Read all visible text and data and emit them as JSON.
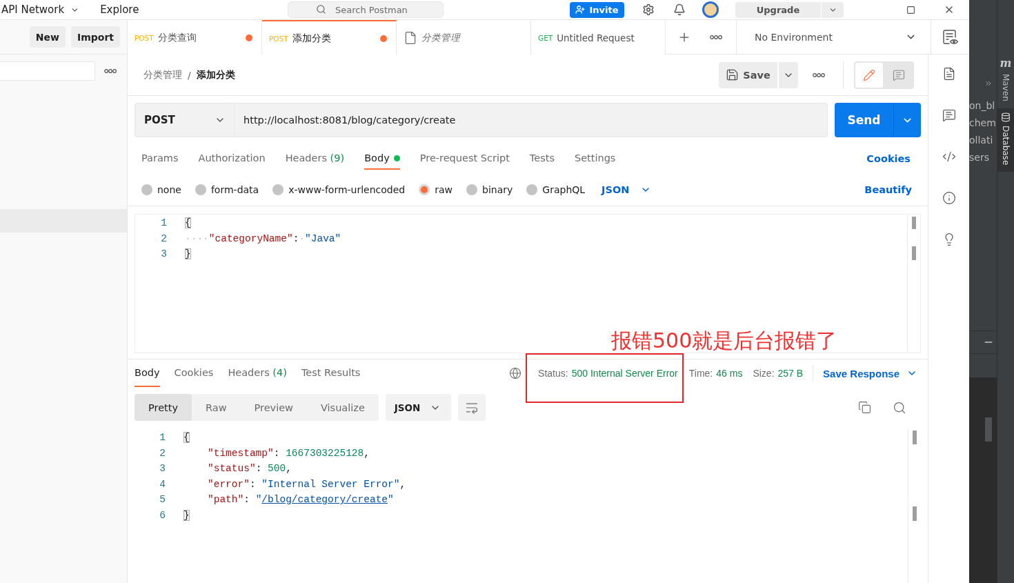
{
  "top_bar": {
    "nav": [
      {
        "label": "API Network",
        "dropdown": true
      },
      {
        "label": "Explore",
        "dropdown": false
      }
    ],
    "search": {
      "placeholder": "Search Postman"
    },
    "invite": "Invite",
    "upgrade": "Upgrade"
  },
  "sidebar": {
    "buttons": [
      "New",
      "Import"
    ]
  },
  "tabs": [
    {
      "kind": "request",
      "method": "POST",
      "color": "#ffb400",
      "title": "分类查询",
      "unsaved": true,
      "selected": false
    },
    {
      "kind": "request",
      "method": "POST",
      "color": "#ffb400",
      "title": "添加分类",
      "unsaved": true,
      "selected": true
    },
    {
      "kind": "collection",
      "title": "分类管理",
      "unsaved": false,
      "selected": false
    },
    {
      "kind": "request",
      "method": "GET",
      "color": "#0cbb52",
      "title": "Untitled Request",
      "unsaved": false,
      "selected": false
    }
  ],
  "environment": {
    "value": "No Environment"
  },
  "breadcrumb": {
    "separator": "/",
    "items": [
      {
        "label": "分类管理",
        "current": false
      },
      {
        "label": "添加分类",
        "current": true
      }
    ]
  },
  "save": {
    "label": "Save"
  },
  "view_toggle": [
    {
      "kind": "edit",
      "selected": true
    },
    {
      "kind": "comments",
      "selected": false
    }
  ],
  "request": {
    "method": "POST",
    "url": "http://localhost:8081/blog/category/create",
    "send": "Send"
  },
  "request_tabs": [
    {
      "label": "Params",
      "selected": false,
      "has_content": false
    },
    {
      "label": "Authorization",
      "selected": false,
      "has_content": false
    },
    {
      "label": "Headers",
      "count": "(9)",
      "selected": false,
      "has_content": false
    },
    {
      "label": "Body",
      "selected": true,
      "has_content": true
    },
    {
      "label": "Pre-request Script",
      "selected": false,
      "has_content": false
    },
    {
      "label": "Tests",
      "selected": false,
      "has_content": false
    },
    {
      "label": "Settings",
      "selected": false,
      "has_content": false
    }
  ],
  "cookies_link": "Cookies",
  "body_types": [
    {
      "label": "none",
      "selected": false
    },
    {
      "label": "form-data",
      "selected": false
    },
    {
      "label": "x-www-form-urlencoded",
      "selected": false
    },
    {
      "label": "raw",
      "selected": true
    },
    {
      "label": "binary",
      "selected": false
    },
    {
      "label": "GraphQL",
      "selected": false
    }
  ],
  "body_format": "JSON",
  "beautify": "Beautify",
  "request_body": [
    {
      "number": "1",
      "tokens": [
        {
          "kind": "brace",
          "text": "{"
        }
      ]
    },
    {
      "number": "2",
      "tokens": [
        {
          "kind": "whitespace",
          "text": "····"
        },
        {
          "kind": "key",
          "text": "\"categoryName\""
        },
        {
          "kind": "punct",
          "text": ":"
        },
        {
          "kind": "whitespace",
          "text": "·"
        },
        {
          "kind": "string",
          "text": "\"Java\""
        }
      ]
    },
    {
      "number": "3",
      "tokens": [
        {
          "kind": "brace",
          "text": "}"
        }
      ]
    }
  ],
  "response_tabs": [
    {
      "label": "Body",
      "selected": true
    },
    {
      "label": "Cookies",
      "selected": false
    },
    {
      "label": "Headers",
      "count": "(4)",
      "selected": false
    },
    {
      "label": "Test Results",
      "selected": false
    }
  ],
  "response_meta": {
    "status_label": "Status:",
    "status": "500 Internal Server Error",
    "time_label": "Time:",
    "time": "46 ms",
    "size_label": "Size:",
    "size": "257 B",
    "save": "Save Response"
  },
  "view_modes": [
    {
      "label": "Pretty",
      "selected": true
    },
    {
      "label": "Raw",
      "selected": false
    },
    {
      "label": "Preview",
      "selected": false
    },
    {
      "label": "Visualize",
      "selected": false
    }
  ],
  "response_format": "JSON",
  "response_body": [
    {
      "number": "1",
      "tokens": [
        {
          "kind": "brace",
          "text": "{"
        }
      ],
      "children": [
        {
          "number": "2",
          "tokens": [
            {
              "kind": "key",
              "text": "\"timestamp\""
            },
            {
              "kind": "punct",
              "text": ": "
            },
            {
              "kind": "number",
              "text": "1667303225128"
            },
            {
              "kind": "punct",
              "text": ","
            }
          ]
        },
        {
          "number": "3",
          "tokens": [
            {
              "kind": "key",
              "text": "\"status\""
            },
            {
              "kind": "punct",
              "text": ": "
            },
            {
              "kind": "number",
              "text": "500"
            },
            {
              "kind": "punct",
              "text": ","
            }
          ]
        },
        {
          "number": "4",
          "tokens": [
            {
              "kind": "key",
              "text": "\"error\""
            },
            {
              "kind": "punct",
              "text": ": "
            },
            {
              "kind": "string",
              "text": "\"Internal Server Error\""
            },
            {
              "kind": "punct",
              "text": ","
            }
          ]
        },
        {
          "number": "5",
          "tokens": [
            {
              "kind": "key",
              "text": "\"path\""
            },
            {
              "kind": "punct",
              "text": ": "
            },
            {
              "kind": "string",
              "text": "\""
            },
            {
              "kind": "link",
              "text": "/blog/category/create"
            },
            {
              "kind": "string",
              "text": "\""
            }
          ]
        }
      ]
    },
    {
      "number": "6",
      "tokens": [
        {
          "kind": "brace",
          "text": "}"
        }
      ]
    }
  ],
  "annotation": {
    "text": "报错500就是后台报错了"
  },
  "ide_panel": {
    "fragments": [
      "on_bl",
      "chem",
      "ollati",
      "sers"
    ],
    "tool_windows": [
      {
        "kind": "lettered",
        "logo": "m",
        "label": "Maven",
        "selected": false
      },
      {
        "kind": "database",
        "label": "Database",
        "selected": true
      }
    ]
  }
}
